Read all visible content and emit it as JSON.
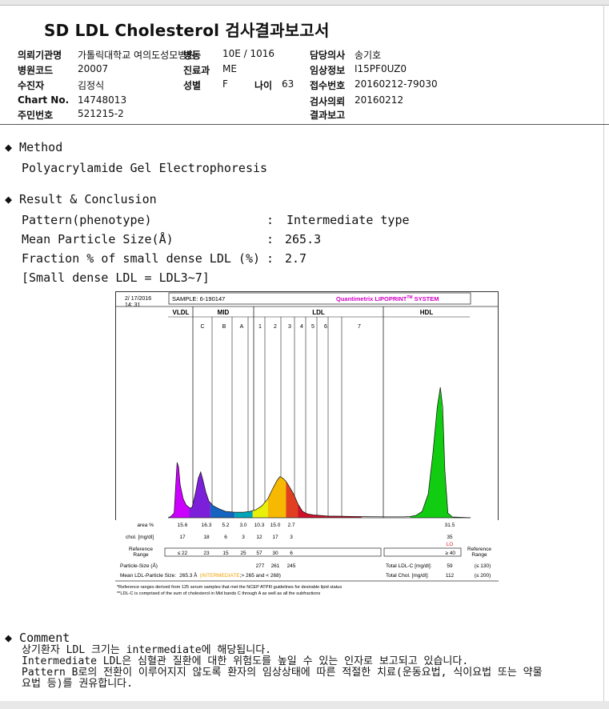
{
  "report": {
    "title": "SD LDL Cholesterol 검사결과보고서",
    "fields": {
      "institution_label": "의뢰기관명",
      "institution_value": "가톨릭대학교 여의도성모병원",
      "ward_label": "병동",
      "ward_value": "10E / 1016",
      "doctor_label": "담당의사",
      "doctor_value": "송기호",
      "hospital_code_label": "병원코드",
      "hospital_code_value": "20007",
      "dept_label": "진료과",
      "dept_value": "ME",
      "clinical_info_label": "임상정보",
      "clinical_info_value": "I15PF0UZ0",
      "patient_label": "수진자",
      "patient_value": "김정식",
      "sex_label": "성별",
      "sex_value": "F",
      "age_label": "나이",
      "age_value": "63",
      "receipt_label": "접수번호",
      "receipt_value": "20160212-79030",
      "chart_label": "Chart No.",
      "chart_value": "14748013",
      "request_label": "검사의뢰",
      "request_value": "20160212",
      "rrn_label": "주민번호",
      "rrn_value": "521215-2",
      "result_report_label": "결과보고"
    },
    "method": {
      "heading": "◆  Method",
      "text": "Polyacrylamide Gel Electrophoresis"
    },
    "result": {
      "heading": "◆  Result & Conclusion",
      "rows": [
        {
          "label": "Pattern(phenotype)",
          "colon": ":",
          "value": "Intermediate type"
        },
        {
          "label": "Mean Particle Size(Å)",
          "colon": ":",
          "value": "265.3"
        },
        {
          "label": "Fraction % of small dense LDL (%)",
          "colon": ":",
          "value": "2.7"
        }
      ],
      "note": "[Small dense LDL = LDL3~7]"
    },
    "comment": {
      "heading": "◆  Comment",
      "lines": [
        "상기환자 LDL 크기는 intermediate에 해당됩니다.",
        "Intermediate LDL은 심혈관 질환에 대한 위험도를 높일 수 있는 인자로 보고되고 있습니다.",
        "Pattern B로의 전환이 이루어지지 않도록 환자의 임상상태에 따른 적절한 치료(운동요법, 식이요법 또는 약물",
        "요법 등)를 권유합니다."
      ]
    }
  },
  "chart_data": {
    "type": "area",
    "header": {
      "date": "2/ 17/2016",
      "time": "14: 31",
      "sample": "SAMPLE:   6-190147",
      "brand": "Quantimetrix LIPOPRINT",
      "brand_tm": "TM",
      "brand_suffix": " SYSTEM"
    },
    "band_groups": [
      {
        "name": "VLDL"
      },
      {
        "name": "MID"
      },
      {
        "name": "LDL"
      },
      {
        "name": "HDL"
      }
    ],
    "bands": [
      "C",
      "B",
      "A",
      "1",
      "2",
      "3",
      "4",
      "5",
      "6",
      "7"
    ],
    "profile": [
      {
        "x": 0.0,
        "y": 0
      },
      {
        "x": 0.01,
        "y": 2
      },
      {
        "x": 0.02,
        "y": 6
      },
      {
        "x": 0.025,
        "y": 40
      },
      {
        "x": 0.03,
        "y": 70
      },
      {
        "x": 0.035,
        "y": 64
      },
      {
        "x": 0.04,
        "y": 42
      },
      {
        "x": 0.05,
        "y": 24
      },
      {
        "x": 0.06,
        "y": 16
      },
      {
        "x": 0.07,
        "y": 13
      },
      {
        "x": 0.075,
        "y": 12
      },
      {
        "x": 0.08,
        "y": 14
      },
      {
        "x": 0.09,
        "y": 30
      },
      {
        "x": 0.1,
        "y": 50
      },
      {
        "x": 0.108,
        "y": 58
      },
      {
        "x": 0.115,
        "y": 48
      },
      {
        "x": 0.125,
        "y": 32
      },
      {
        "x": 0.135,
        "y": 21
      },
      {
        "x": 0.15,
        "y": 15
      },
      {
        "x": 0.17,
        "y": 11
      },
      {
        "x": 0.19,
        "y": 8
      },
      {
        "x": 0.22,
        "y": 7
      },
      {
        "x": 0.25,
        "y": 7
      },
      {
        "x": 0.27,
        "y": 8
      },
      {
        "x": 0.29,
        "y": 10
      },
      {
        "x": 0.31,
        "y": 15
      },
      {
        "x": 0.33,
        "y": 24
      },
      {
        "x": 0.345,
        "y": 36
      },
      {
        "x": 0.36,
        "y": 47
      },
      {
        "x": 0.37,
        "y": 52
      },
      {
        "x": 0.38,
        "y": 50
      },
      {
        "x": 0.39,
        "y": 46
      },
      {
        "x": 0.4,
        "y": 40
      },
      {
        "x": 0.415,
        "y": 30
      },
      {
        "x": 0.43,
        "y": 17
      },
      {
        "x": 0.445,
        "y": 8
      },
      {
        "x": 0.46,
        "y": 5
      },
      {
        "x": 0.48,
        "y": 3.5
      },
      {
        "x": 0.5,
        "y": 3
      },
      {
        "x": 0.53,
        "y": 2
      },
      {
        "x": 0.56,
        "y": 2
      },
      {
        "x": 0.6,
        "y": 1.6
      },
      {
        "x": 0.65,
        "y": 1.4
      },
      {
        "x": 0.72,
        "y": 1.2
      },
      {
        "x": 0.78,
        "y": 1.2
      },
      {
        "x": 0.8,
        "y": 1.5
      },
      {
        "x": 0.82,
        "y": 3
      },
      {
        "x": 0.84,
        "y": 8
      },
      {
        "x": 0.86,
        "y": 30
      },
      {
        "x": 0.875,
        "y": 80
      },
      {
        "x": 0.89,
        "y": 140
      },
      {
        "x": 0.9,
        "y": 165
      },
      {
        "x": 0.908,
        "y": 140
      },
      {
        "x": 0.915,
        "y": 60
      },
      {
        "x": 0.925,
        "y": 6
      },
      {
        "x": 0.94,
        "y": 1
      },
      {
        "x": 1.0,
        "y": 0
      }
    ],
    "ylim": [
      0,
      175
    ],
    "fractions": [
      {
        "x0": 0.0,
        "x1": 0.07,
        "color": "#cc00ff"
      },
      {
        "x0": 0.07,
        "x1": 0.14,
        "color": "#7b1fd8"
      },
      {
        "x0": 0.14,
        "x1": 0.22,
        "color": "#1565c0"
      },
      {
        "x0": 0.22,
        "x1": 0.28,
        "color": "#00a6b8"
      },
      {
        "x0": 0.28,
        "x1": 0.33,
        "color": "#e8f00a"
      },
      {
        "x0": 0.33,
        "x1": 0.39,
        "color": "#f6b800"
      },
      {
        "x0": 0.39,
        "x1": 0.43,
        "color": "#e04020"
      },
      {
        "x0": 0.43,
        "x1": 0.64,
        "color": "#d0102a"
      },
      {
        "x0": 0.8,
        "x1": 1.0,
        "color": "#11cc11"
      }
    ],
    "table": {
      "area_label": "area %",
      "area": [
        "15.6",
        "16.3",
        "5.2",
        "3.0",
        "10.3",
        "15.0",
        "2.7",
        "",
        "",
        "31.5"
      ],
      "chol_label": "chol. [mg/dl]",
      "chol": [
        "17",
        "18",
        "6",
        "3",
        "12",
        "17",
        "3",
        "",
        "",
        "35"
      ],
      "lo_flag": "LO",
      "ref_label_1": "Reference",
      "ref_label_2": "Range",
      "ref": [
        "≤ 22",
        "23",
        "15",
        "25",
        "57",
        "30",
        "6"
      ],
      "hdl_ref": "≥ 40",
      "ref_right_1": "Reference",
      "ref_right_2": "Range",
      "particle_size_label": "Particle-Size (Å)",
      "particle_sizes": [
        "277",
        "261",
        "245"
      ],
      "total_ldlc_label": "Total LDL-C [mg/dl]:",
      "total_ldlc_value": "59",
      "total_ldlc_ref": "(≤ 130)",
      "mean_size_label": "Mean LDL-Particle Size:",
      "mean_size_value": "265.3 Å",
      "mean_size_class": "(INTERMEDIATE",
      "mean_size_range": ";> 265 and < 268)",
      "total_chol_label": "Total Chol. [mg/dl]:",
      "total_chol_value": "112",
      "total_chol_ref": "(≤ 200)"
    },
    "footnote_1": "*Reference ranges derived from 125 serum samples that met the NCEP ATPIII guidelines for desirable lipid status",
    "footnote_2": "**LDL-C is comprised of the sum of cholesterol in Mid bands C through A as well as all the subfractions"
  }
}
